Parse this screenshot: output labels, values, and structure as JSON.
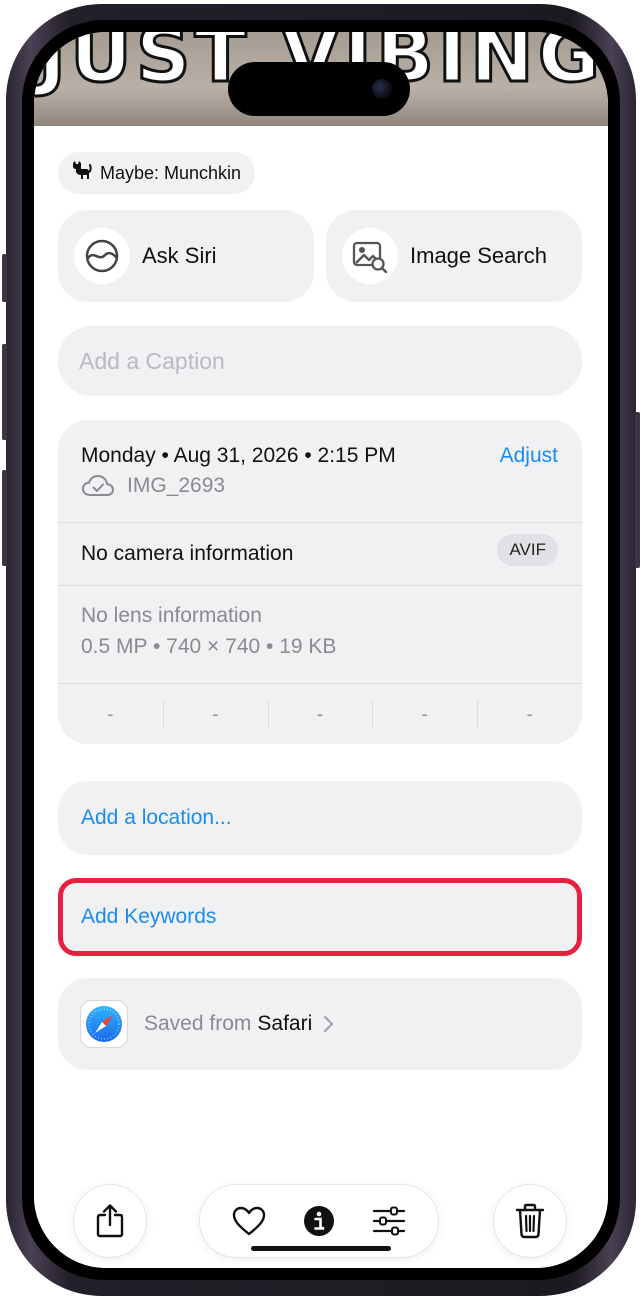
{
  "photo": {
    "overlay_text": "JUST VIBING"
  },
  "lookup": {
    "prefix": "Maybe:",
    "subject": "Munchkin",
    "label": "Maybe: Munchkin",
    "icon": "cat-icon"
  },
  "actions": {
    "ask_siri": {
      "label": "Ask Siri",
      "icon": "siri-icon"
    },
    "image_search": {
      "label": "Image Search",
      "icon": "image-search-icon"
    }
  },
  "caption": {
    "placeholder": "Add a Caption",
    "value": ""
  },
  "details": {
    "date_time": "Monday • Aug 31, 2026 • 2:15 PM",
    "adjust_label": "Adjust",
    "filename": "IMG_2693",
    "camera": "No camera information",
    "format_badge": "AVIF",
    "lens": "No lens information",
    "specs": "0.5 MP • 740 × 740 • 19 KB",
    "exif": [
      "-",
      "-",
      "-",
      "-",
      "-"
    ]
  },
  "location": {
    "label": "Add a location..."
  },
  "keywords": {
    "label": "Add Keywords"
  },
  "source": {
    "prefix": "Saved from",
    "app": "Safari",
    "icon": "safari-icon"
  },
  "toolbar": {
    "share_icon": "share-icon",
    "favorite_icon": "heart-icon",
    "info_icon": "info-icon",
    "adjust_icon": "sliders-icon",
    "delete_icon": "trash-icon"
  },
  "colors": {
    "accent": "#1a8cf0",
    "highlight": "#e5213f",
    "card_background": "#f1f1f4",
    "secondary_text": "#8a8a8f"
  }
}
